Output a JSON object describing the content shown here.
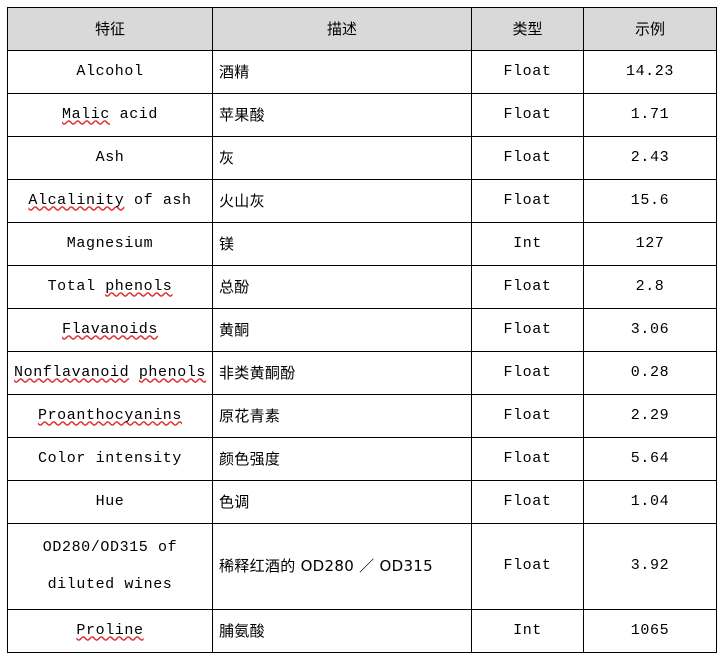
{
  "table": {
    "headers": [
      {
        "label": "特征"
      },
      {
        "label": "描述"
      },
      {
        "label": "类型"
      },
      {
        "label": "示例"
      }
    ],
    "header_background": "#d9d9d9",
    "border_color": "#000000",
    "spellcheck_underline_color": "#e03030",
    "rows": [
      {
        "feature": "Alcohol",
        "feature_line1": "Alcohol",
        "feature_line2": "",
        "description": "酒精",
        "type": "Float",
        "example": "14.23"
      },
      {
        "feature": "Malic acid",
        "feature_line1": "Malic acid",
        "feature_line2": "",
        "description": "苹果酸",
        "type": "Float",
        "example": "1.71"
      },
      {
        "feature": "Ash",
        "feature_line1": "Ash",
        "feature_line2": "",
        "description": "灰",
        "type": "Float",
        "example": "2.43"
      },
      {
        "feature": "Alcalinity of ash",
        "feature_line1": "Alcalinity of ash",
        "feature_line2": "",
        "description": "火山灰",
        "type": "Float",
        "example": "15.6"
      },
      {
        "feature": "Magnesium",
        "feature_line1": "Magnesium",
        "feature_line2": "",
        "description": "镁",
        "type": "Int",
        "example": "127"
      },
      {
        "feature": "Total phenols",
        "feature_line1": "Total phenols",
        "feature_line2": "",
        "description": "总酚",
        "type": "Float",
        "example": "2.8"
      },
      {
        "feature": "Flavanoids",
        "feature_line1": "Flavanoids",
        "feature_line2": "",
        "description": "黄酮",
        "type": "Float",
        "example": "3.06"
      },
      {
        "feature": "Nonflavanoid phenols",
        "feature_line1": "Nonflavanoid phenols",
        "feature_line2": "",
        "description": "非类黄酮酚",
        "type": "Float",
        "example": "0.28"
      },
      {
        "feature": "Proanthocyanins",
        "feature_line1": "Proanthocyanins",
        "feature_line2": "",
        "description": "原花青素",
        "type": "Float",
        "example": "2.29"
      },
      {
        "feature": "Color intensity",
        "feature_line1": "Color intensity",
        "feature_line2": "",
        "description": "颜色强度",
        "type": "Float",
        "example": "5.64"
      },
      {
        "feature": "Hue",
        "feature_line1": "Hue",
        "feature_line2": "",
        "description": "色调",
        "type": "Float",
        "example": "1.04"
      },
      {
        "feature": "OD280/OD315 of diluted wines",
        "feature_line1": "OD280/OD315 of",
        "feature_line2": "diluted wines",
        "description": "稀释红酒的 OD280 ／ OD315",
        "type": "Float",
        "example": "3.92"
      },
      {
        "feature": "Proline",
        "feature_line1": "Proline",
        "feature_line2": "",
        "description": "脯氨酸",
        "type": "Int",
        "example": "1065"
      }
    ]
  }
}
